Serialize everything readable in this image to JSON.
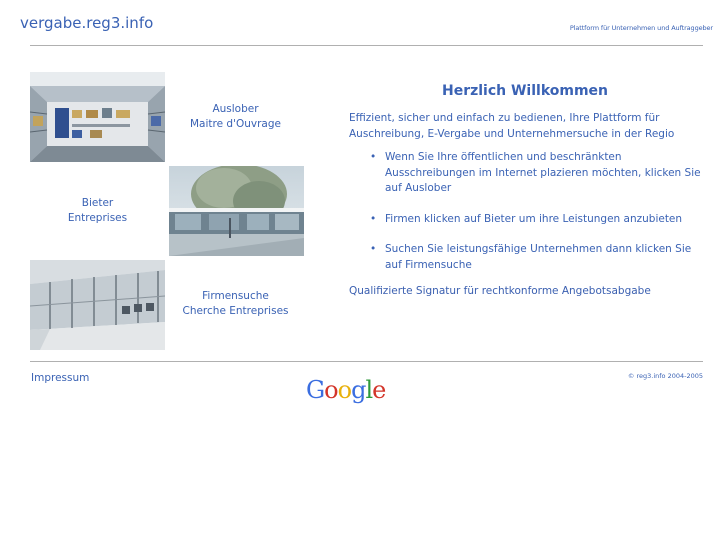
{
  "header": {
    "site_title": "vergabe.reg3.info",
    "tagline": "Plattform für Unternehmen und Auftraggeber"
  },
  "nav": {
    "auslober": {
      "line1": "Auslober",
      "line2": "Maitre d'Ouvrage"
    },
    "bieter": {
      "line1": "Bieter",
      "line2": "Entreprises"
    },
    "firmensuche": {
      "line1": "Firmensuche",
      "line2": "Cherche Entreprises"
    }
  },
  "welcome": {
    "title": "Herzlich Willkommen",
    "intro": "Effizient, sicher und einfach zu bedienen, Ihre Plattform für Auschreibung, E-Vergabe und Unternehmersuche in der Regio",
    "bullets": [
      "Wenn Sie Ihre öffentlichen und beschränkten Ausschreibungen im Internet plazieren möchten, klicken Sie auf Auslober",
      "Firmen klicken auf Bieter um ihre Leistungen anzubieten",
      "Suchen Sie leistungsfähige Unternehmen dann klicken Sie auf Firmensuche"
    ],
    "signatur": "Qualifizierte Signatur für rechtkonforme Angebotsabgabe"
  },
  "footer": {
    "impressum": "Impressum",
    "copyright": "© reg3.info 2004-2005",
    "google_letters": [
      "G",
      "o",
      "o",
      "g",
      "l",
      "e"
    ],
    "google_colors": [
      "#3b6ee0",
      "#d3352a",
      "#e8b10c",
      "#3b6ee0",
      "#2f9a3c",
      "#d3352a"
    ]
  },
  "colors": {
    "link": "#3a62b4",
    "rule": "#b0b0b0"
  }
}
